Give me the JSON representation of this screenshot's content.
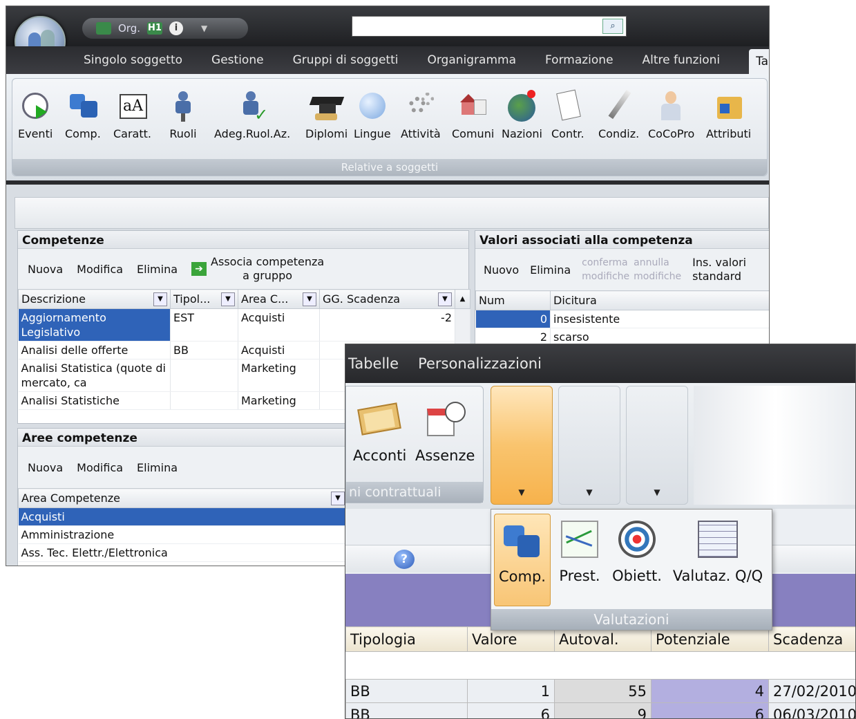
{
  "top_window": {
    "qat": {
      "org_label": "Org.",
      "h_label": "H1",
      "info_label": "i",
      "dropdown": "▼"
    },
    "tabs": [
      "Singolo soggetto",
      "Gestione",
      "Gruppi di soggetti",
      "Organigramma",
      "Formazione",
      "Altre funzioni",
      "Tabelle"
    ],
    "ribbon": {
      "buttons": [
        "Eventi",
        "Comp.",
        "Caratt.",
        "Ruoli",
        "Adeg.Ruol.Az.",
        "Diplomi",
        "Lingue",
        "Attività",
        "Comuni",
        "Nazioni",
        "Contr.",
        "Condiz.",
        "CoCoPro",
        "Attributi"
      ],
      "group_label": "Relative a soggetti"
    },
    "competenze": {
      "title": "Competenze",
      "toolbar": {
        "new": "Nuova",
        "edit": "Modifica",
        "delete": "Elimina",
        "assoc_line1": "Associa competenza",
        "assoc_line2": "a gruppo"
      },
      "columns": [
        "Descrizione",
        "Tipol...",
        "Area C...",
        "GG. Scadenza"
      ],
      "rows": [
        {
          "desc": "Aggiornamento Legislativo",
          "tipo": "EST",
          "area": "Acquisti",
          "gg": "-2"
        },
        {
          "desc": "Analisi delle offerte",
          "tipo": "BB",
          "area": "Acquisti",
          "gg": ""
        },
        {
          "desc": "Analisi Statistica (quote di mercato, ca",
          "tipo": "",
          "area": "Marketing",
          "gg": ""
        },
        {
          "desc": "Analisi Statistiche",
          "tipo": "",
          "area": "Marketing",
          "gg": ""
        }
      ]
    },
    "valori": {
      "title": "Valori associati alla competenza",
      "toolbar": {
        "new": "Nuovo",
        "delete": "Elimina",
        "confirm_line1": "conferma",
        "confirm_line2": "modifiche",
        "cancel_line1": "annulla",
        "cancel_line2": "modifiche",
        "ins_line1": "Ins. valori",
        "ins_line2": "standard"
      },
      "columns": [
        "Num",
        "Dicitura"
      ],
      "rows": [
        {
          "num": "0",
          "label": "insesistente"
        },
        {
          "num": "2",
          "label": "scarso"
        }
      ]
    },
    "aree": {
      "title": "Aree competenze",
      "toolbar": {
        "new": "Nuova",
        "edit": "Modifica",
        "delete": "Elimina"
      },
      "column": "Area Competenze",
      "rows": [
        "Acquisti",
        "Amministrazione",
        "Ass. Tec. Elettr./Elettronica"
      ]
    }
  },
  "bottom_window": {
    "tabs": [
      "Tabelle",
      "Personalizzazioni"
    ],
    "group": {
      "buttons": [
        "Acconti",
        "Assenze"
      ],
      "label": "ni contrattuali"
    },
    "popup": {
      "buttons": [
        "Comp.",
        "Prest.",
        "Obiett.",
        "Valutaz. Q/Q"
      ],
      "label": "Valutazioni"
    },
    "help_icon": "?",
    "table": {
      "columns": [
        "Tipologia",
        "Valore",
        "Autoval.",
        "Potenziale",
        "Scadenza"
      ],
      "rows": [
        {
          "tipo": "BB",
          "valore": "1",
          "autoval": "55",
          "potenziale": "4",
          "scadenza": "27/02/2010"
        },
        {
          "tipo": "BB",
          "valore": "6",
          "autoval": "9",
          "potenziale": "6",
          "scadenza": "06/03/2010"
        }
      ]
    }
  }
}
